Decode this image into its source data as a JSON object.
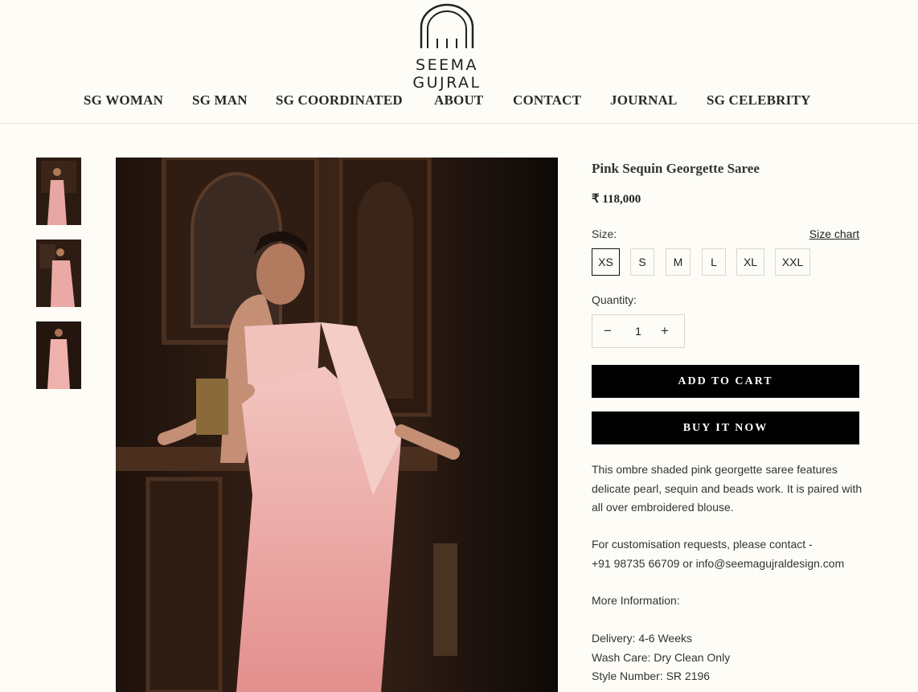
{
  "brand": {
    "name": "SEEMA GUJRAL"
  },
  "nav": [
    "SG WOMAN",
    "SG MAN",
    "SG COORDINATED",
    "ABOUT",
    "CONTACT",
    "JOURNAL",
    "SG CELEBRITY"
  ],
  "product": {
    "title": "Pink Sequin Georgette Saree",
    "price": "₹ 118,000",
    "size_label": "Size:",
    "size_chart": "Size chart",
    "sizes": [
      "XS",
      "S",
      "M",
      "L",
      "XL",
      "XXL"
    ],
    "selected_size": "XS",
    "quantity_label": "Quantity:",
    "quantity": "1",
    "add_to_cart": "ADD TO CART",
    "buy_now": "BUY IT NOW",
    "description": [
      "This ombre shaded pink georgette saree features",
      "delicate pearl, sequin and beads work. It is paired with",
      "all over embroidered blouse."
    ],
    "customisation": [
      "For customisation requests, please contact -",
      "+91 98735 66709 or info@seemagujraldesign.com"
    ],
    "more_info_label": "More Information:",
    "details": [
      "Delivery: 4-6 Weeks",
      "Wash Care: Dry Clean Only",
      "Style Number: SR 2196"
    ]
  },
  "colors": {
    "background": "#fdfcf7",
    "button": "#000000",
    "saree_pink": "#e9a8a4"
  },
  "icons": {
    "minus": "−",
    "plus": "+"
  }
}
